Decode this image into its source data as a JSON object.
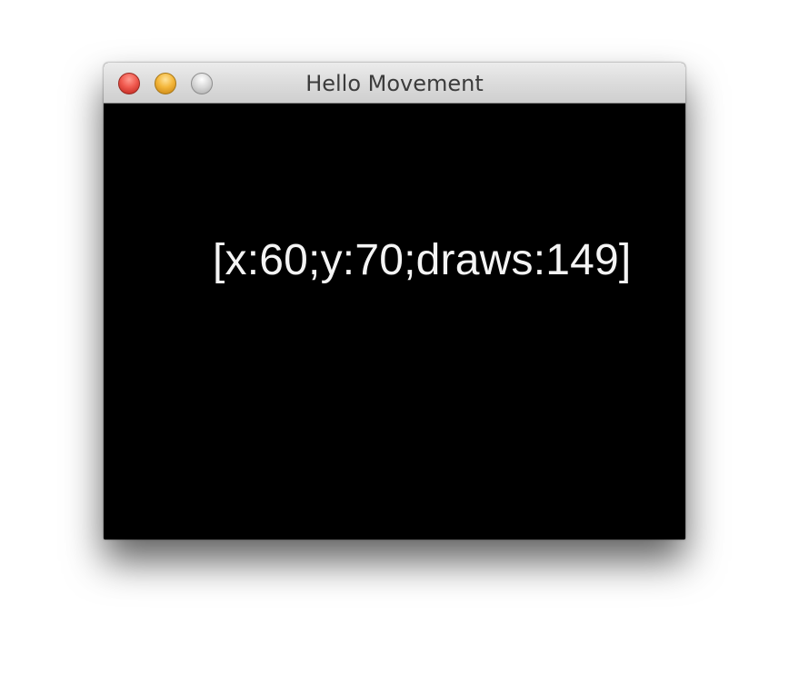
{
  "window": {
    "title": "Hello Movement",
    "controls": {
      "close": {
        "icon": "close-icon",
        "color": "#f05a4f"
      },
      "minimize": {
        "icon": "minimize-icon",
        "color": "#f4b73b"
      },
      "zoom": {
        "icon": "zoom-icon",
        "color": "#d6d6d6"
      }
    }
  },
  "canvas": {
    "background": "#000000",
    "readout": "[x:60;y:70;draws:149]",
    "text_color": "#f4f4f4"
  }
}
